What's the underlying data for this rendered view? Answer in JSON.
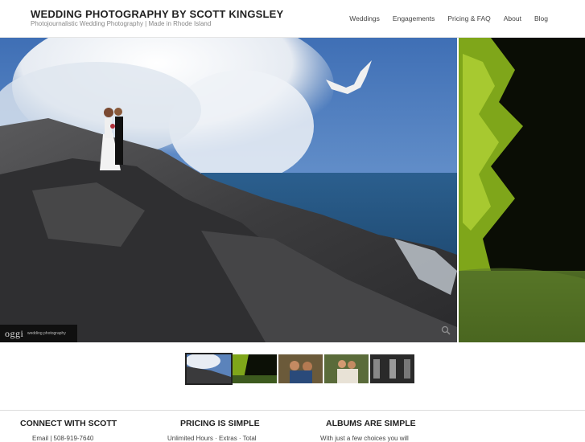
{
  "header": {
    "title": "WEDDING PHOTOGRAPHY BY SCOTT KINGSLEY",
    "tagline": "Photojournalistic Wedding Photography | Made in Rhode Island"
  },
  "nav": {
    "items": [
      "Weddings",
      "Engagements",
      "Pricing & FAQ",
      "About",
      "Blog"
    ]
  },
  "hero": {
    "watermark_logo": "oggi",
    "watermark_sub": "wedding photography"
  },
  "thumbnails": {
    "count": 5,
    "active_index": 0
  },
  "footer": {
    "col1_title": "CONNECT WITH SCOTT",
    "col1_sub": "Email | 508-919-7640",
    "col2_title": "PRICING IS SIMPLE",
    "col2_sub": "Unlimited Hours · Extras · Total",
    "col3_title": "ALBUMS ARE SIMPLE",
    "col3_sub": "With just a few choices you will"
  },
  "colors": {
    "sky": "#4f7fc0",
    "rock": "#3e3e40",
    "foliage": "#8fb61e",
    "header_text": "#222222"
  }
}
